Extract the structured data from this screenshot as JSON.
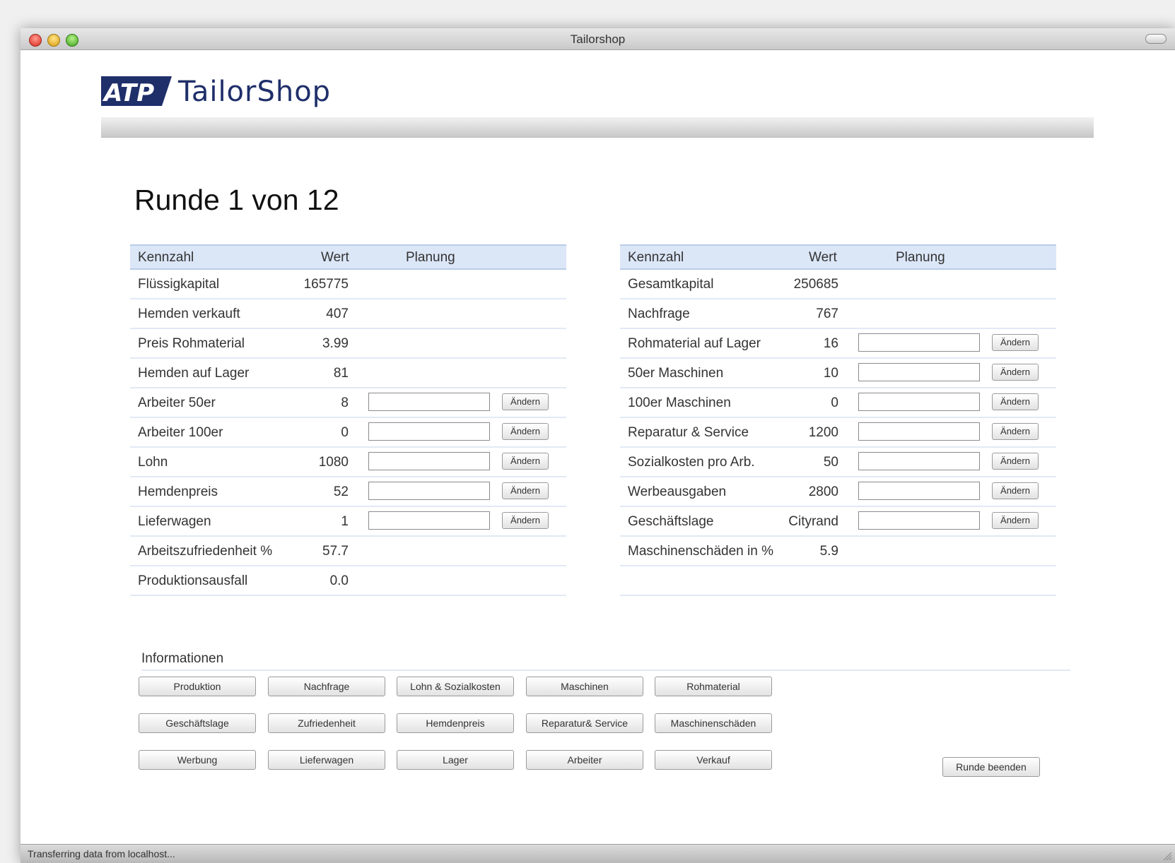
{
  "window": {
    "title": "Tailorshop"
  },
  "logo": {
    "badge_text": "ATP",
    "text": "TailorShop"
  },
  "round_title": "Runde 1 von 12",
  "table_headers": {
    "kennzahl": "Kennzahl",
    "wert": "Wert",
    "planung": "Planung"
  },
  "change_label": "Ändern",
  "left_table": [
    {
      "label": "Flüssigkapital",
      "value": "165775",
      "editable": false
    },
    {
      "label": "Hemden verkauft",
      "value": "407",
      "editable": false
    },
    {
      "label": "Preis Rohmaterial",
      "value": "3.99",
      "editable": false
    },
    {
      "label": "Hemden auf Lager",
      "value": "81",
      "editable": false
    },
    {
      "label": "Arbeiter 50er",
      "value": "8",
      "editable": true
    },
    {
      "label": "Arbeiter 100er",
      "value": "0",
      "editable": true
    },
    {
      "label": "Lohn",
      "value": "1080",
      "editable": true
    },
    {
      "label": "Hemdenpreis",
      "value": "52",
      "editable": true
    },
    {
      "label": "Lieferwagen",
      "value": "1",
      "editable": true
    },
    {
      "label": "Arbeitszufriedenheit %",
      "value": "57.7",
      "editable": false
    },
    {
      "label": "Produktionsausfall",
      "value": "0.0",
      "editable": false
    }
  ],
  "right_table": [
    {
      "label": "Gesamtkapital",
      "value": "250685",
      "editable": false
    },
    {
      "label": "Nachfrage",
      "value": "767",
      "editable": false
    },
    {
      "label": "Rohmaterial auf Lager",
      "value": "16",
      "editable": true
    },
    {
      "label": "50er Maschinen",
      "value": "10",
      "editable": true
    },
    {
      "label": "100er Maschinen",
      "value": "0",
      "editable": true
    },
    {
      "label": "Reparatur & Service",
      "value": "1200",
      "editable": true
    },
    {
      "label": "Sozialkosten pro Arb.",
      "value": "50",
      "editable": true
    },
    {
      "label": "Werbeausgaben",
      "value": "2800",
      "editable": true
    },
    {
      "label": "Geschäftslage",
      "value": "Cityrand",
      "editable": true
    },
    {
      "label": "Maschinenschäden in %",
      "value": "5.9",
      "editable": false
    },
    {
      "label": "",
      "value": "",
      "editable": false
    }
  ],
  "info": {
    "label": "Informationen",
    "buttons": [
      [
        "Produktion",
        "Nachfrage",
        "Lohn & Sozialkosten",
        "Maschinen",
        "Rohmaterial"
      ],
      [
        "Geschäftslage",
        "Zufriedenheit",
        "Hemdenpreis",
        "Reparatur& Service",
        "Maschinenschäden"
      ],
      [
        "Werbung",
        "Lieferwagen",
        "Lager",
        "Arbeiter",
        "Verkauf"
      ]
    ],
    "end_round": "Runde beenden"
  },
  "status": "Transferring data from localhost...",
  "colors": {
    "table_header_bg": "#dbe6f7",
    "logo_navy": "#1f2f6a"
  }
}
